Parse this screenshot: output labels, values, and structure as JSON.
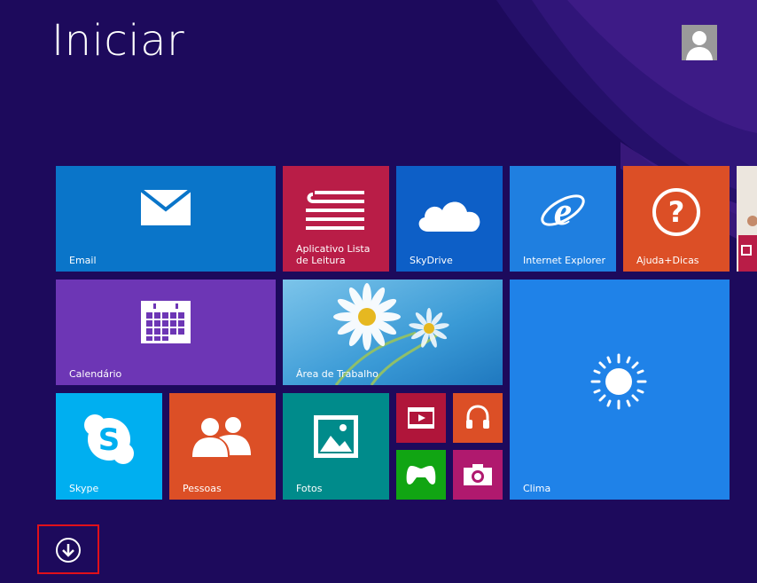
{
  "start": {
    "title": "Iniciar"
  },
  "tiles": {
    "email": {
      "label": "Email",
      "color": "#0a75c9"
    },
    "reading_list": {
      "label": "Aplicativo Lista de Leitura",
      "color": "#b91d47"
    },
    "skydrive": {
      "label": "SkyDrive",
      "color": "#0d5fc7"
    },
    "internet_explorer": {
      "label": "Internet Explorer",
      "color": "#1f7fe0"
    },
    "help_tips": {
      "label": "Ajuda+Dicas",
      "color": "#dc4f26"
    },
    "calendar": {
      "label": "Calendário",
      "color": "#6d36b5"
    },
    "desktop": {
      "label": "Área de Trabalho",
      "color": "#3ea0d9"
    },
    "weather": {
      "label": "Clima",
      "color": "#1f82e8"
    },
    "skype": {
      "label": "Skype",
      "color": "#00aff0"
    },
    "people": {
      "label": "Pessoas",
      "color": "#dc4f26"
    },
    "photos": {
      "label": "Fotos",
      "color": "#008b8b"
    },
    "video": {
      "label": "",
      "color": "#b0153a"
    },
    "music": {
      "label": "",
      "color": "#dc4f26"
    },
    "games": {
      "label": "",
      "color": "#11a513"
    },
    "camera": {
      "label": "",
      "color": "#b0196e"
    }
  },
  "icons": {
    "avatar": "user-avatar-icon",
    "scroll_down": "arrow-down-circle-icon"
  }
}
